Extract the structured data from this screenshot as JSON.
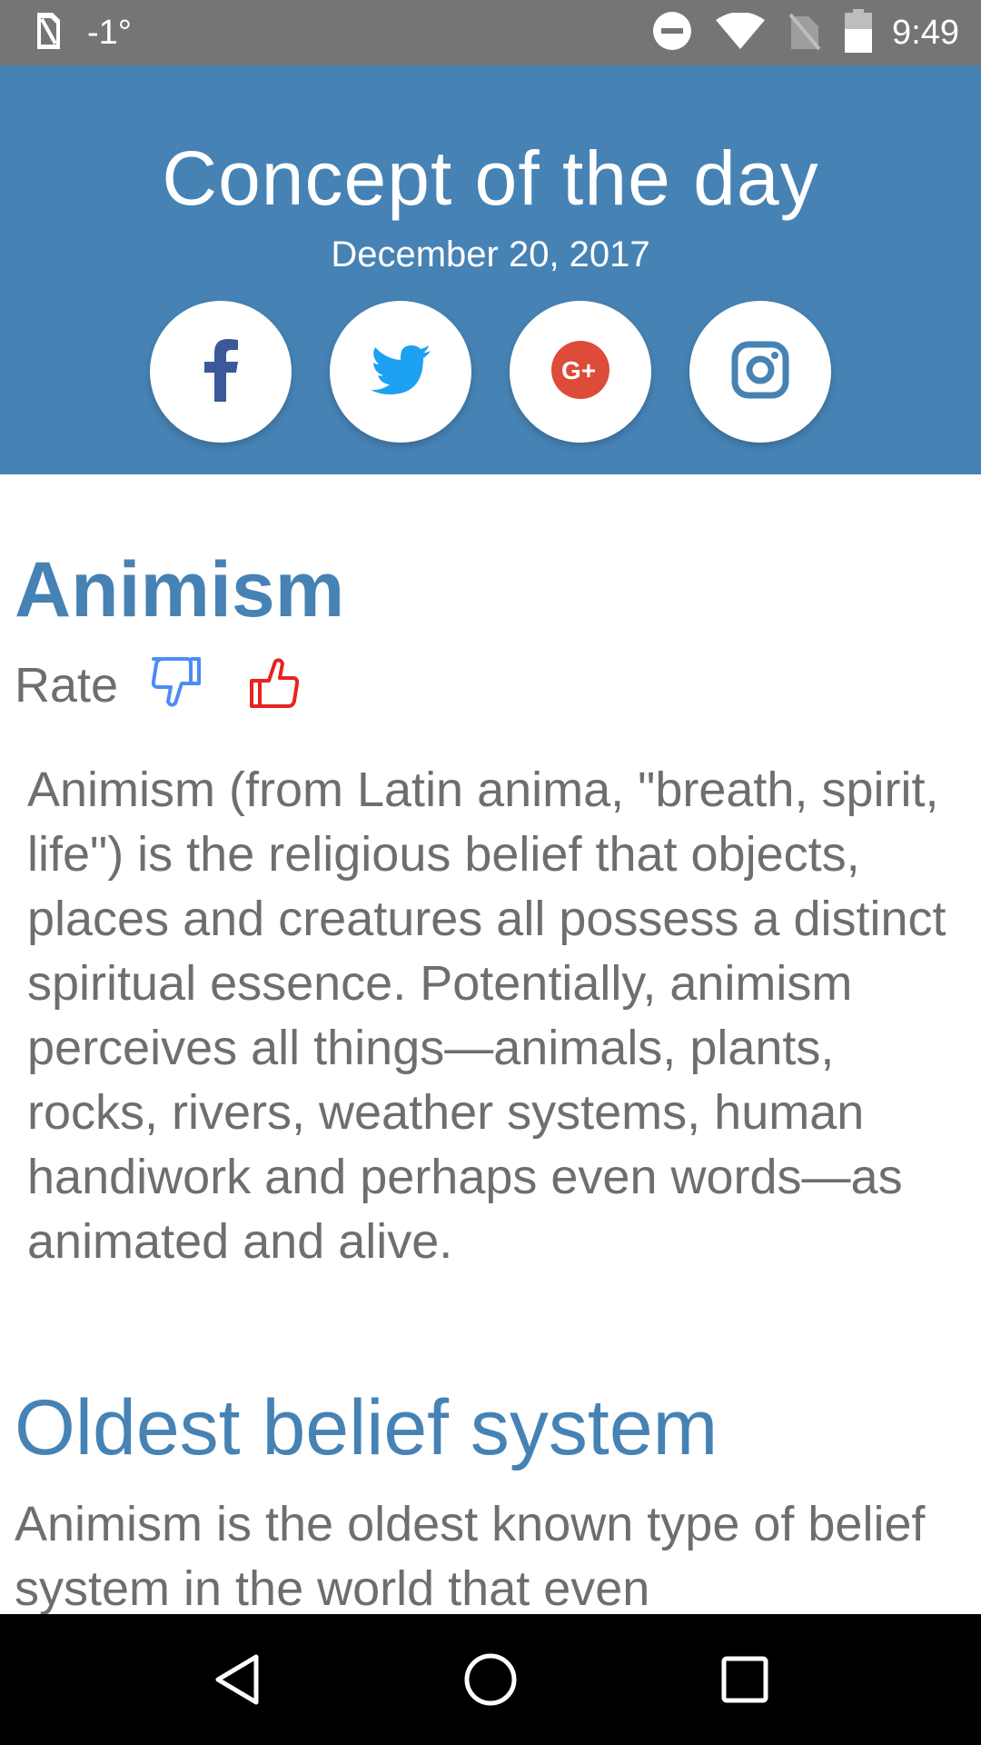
{
  "status_bar": {
    "temperature": "-1°",
    "time": "9:49",
    "icons": [
      "sim-card-icon",
      "do-not-disturb-icon",
      "wifi-icon",
      "no-sim-icon",
      "battery-icon"
    ]
  },
  "header": {
    "title": "Concept of the day",
    "date": "December 20, 2017",
    "background_color": "#4682b4",
    "social_buttons": [
      {
        "name": "facebook-icon",
        "color": "#3b5998"
      },
      {
        "name": "twitter-icon",
        "color": "#1da1f2"
      },
      {
        "name": "google-plus-icon",
        "color": "#dd4b39"
      },
      {
        "name": "instagram-icon",
        "color": "#4682b4"
      }
    ]
  },
  "concept": {
    "title": "Animism",
    "rate_label": "Rate",
    "thumb_down_color": "#4d8cf5",
    "thumb_up_color": "#e8231f",
    "body": "Animism (from Latin anima, \"breath, spirit, life\") is the religious belief that objects, places and creatures all possess a distinct spiritual essence. Potentially, animism perceives all things—animals, plants, rocks, rivers, weather systems, human handiwork and perhaps even words—as animated and alive."
  },
  "section": {
    "heading": "Oldest belief system",
    "body": "Animism is the oldest known type of belief system in the world that even"
  },
  "nav_bar": {
    "buttons": [
      "back-icon",
      "home-icon",
      "recents-icon"
    ]
  }
}
